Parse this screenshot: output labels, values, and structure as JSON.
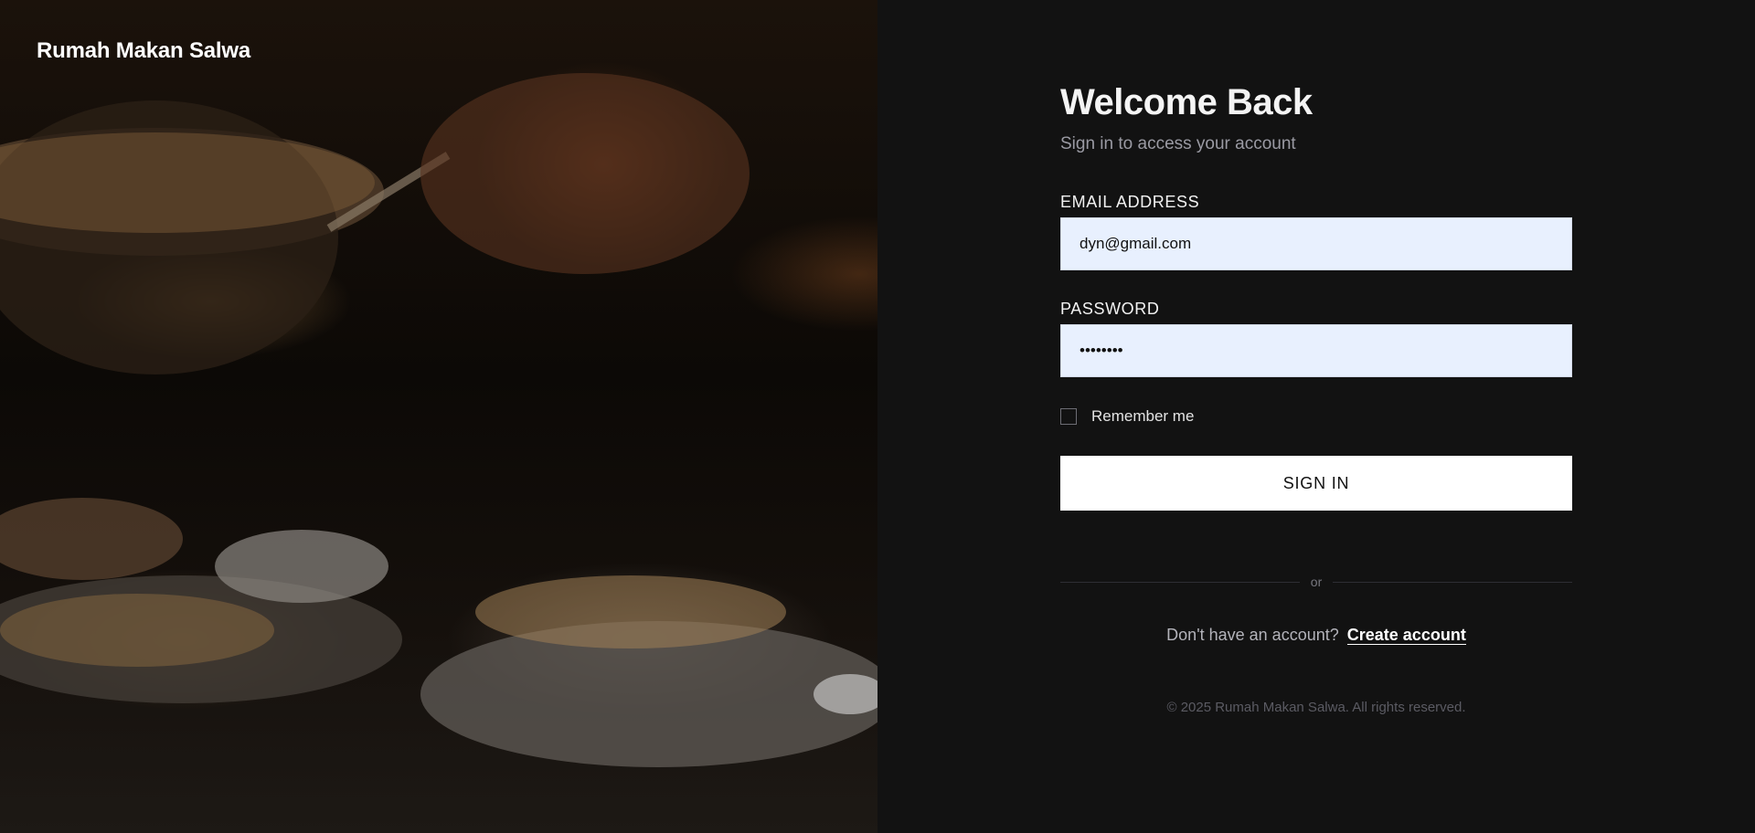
{
  "brand": {
    "name": "Rumah Makan Salwa"
  },
  "login": {
    "title": "Welcome Back",
    "subtitle": "Sign in to access your account",
    "email_label": "EMAIL ADDRESS",
    "email_value": "dyn@gmail.com",
    "password_label": "PASSWORD",
    "password_value": "••••••••",
    "remember_label": "Remember me",
    "remember_checked": false,
    "submit_label": "SIGN IN",
    "divider_text": "or",
    "signup_prompt": "Don't have an account?",
    "signup_link": "Create account",
    "copyright": "© 2025 Rumah Makan Salwa. All rights reserved."
  },
  "colors": {
    "background": "#121212",
    "input_bg": "#e8f0fe",
    "button_bg": "#ffffff",
    "text_muted": "#9a9aa3"
  }
}
